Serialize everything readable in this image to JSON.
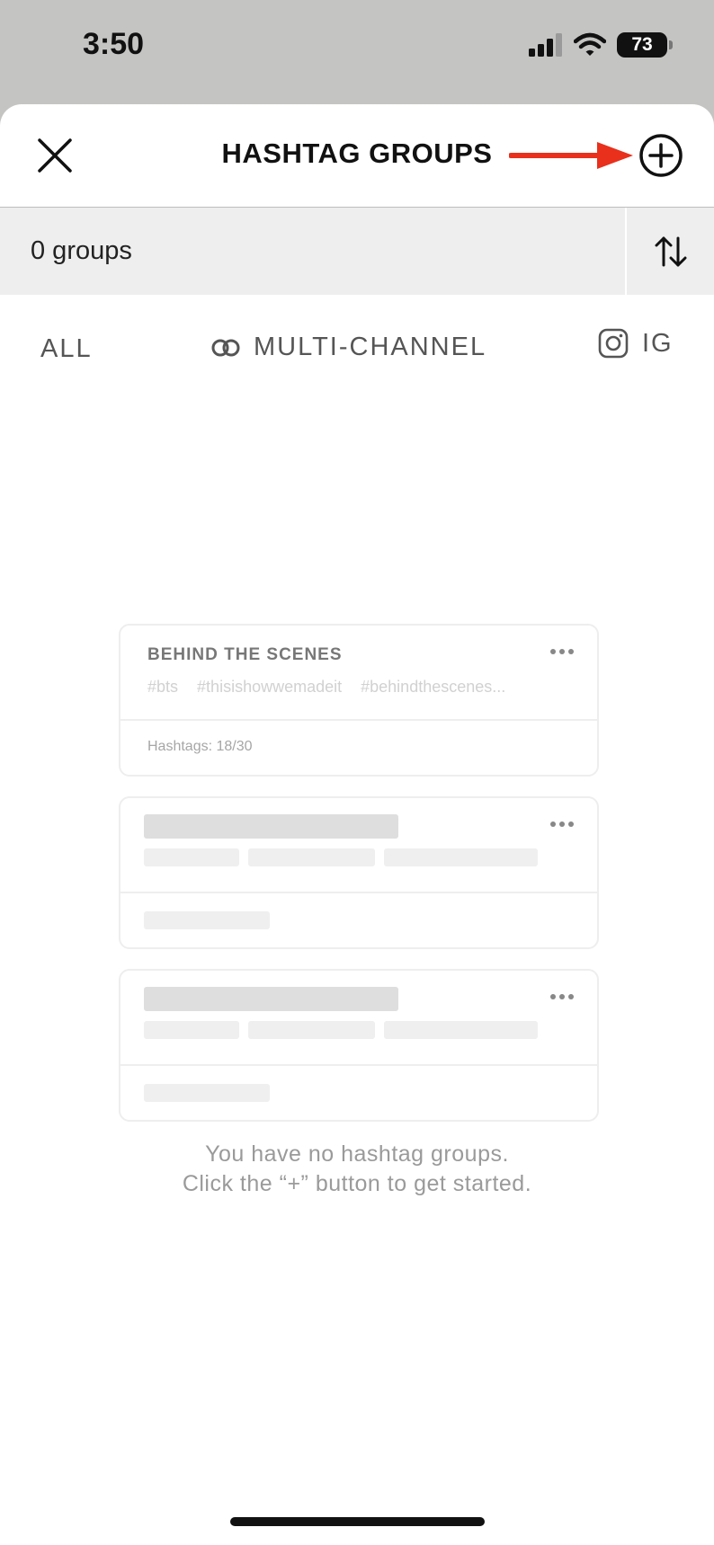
{
  "status_bar": {
    "time": "3:50",
    "battery": "73"
  },
  "header": {
    "title": "HASHTAG GROUPS"
  },
  "groups_bar": {
    "count": "0 groups"
  },
  "filters": {
    "all": "ALL",
    "multi_channel": "MULTI-CHANNEL",
    "ig": "IG"
  },
  "example_card": {
    "title": "BEHIND THE SCENES",
    "tags": [
      "#bts",
      "#thisishowwemadeit",
      "#behindthescenes..."
    ],
    "count": "Hashtags: 18/30"
  },
  "empty_state": {
    "line1": "You have no hashtag groups.",
    "line2": "Click the “+” button to get started."
  },
  "colors": {
    "annotation_arrow": "#e8301c"
  },
  "icons": [
    "close-icon",
    "add-circle-icon",
    "sort-icon",
    "multi-channel-icon",
    "instagram-icon",
    "more-dots-icon"
  ]
}
